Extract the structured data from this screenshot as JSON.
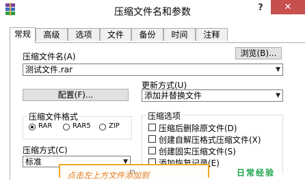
{
  "window": {
    "title": "压缩文件名和参数",
    "help_label": "?",
    "close_label": "✕",
    "app_icon": "winrar-books-icon"
  },
  "tabs": [
    {
      "label": "常规",
      "active": true
    },
    {
      "label": "高级",
      "active": false
    },
    {
      "label": "选项",
      "active": false
    },
    {
      "label": "文件",
      "active": false
    },
    {
      "label": "备份",
      "active": false
    },
    {
      "label": "时间",
      "active": false
    },
    {
      "label": "注释",
      "active": false
    }
  ],
  "general": {
    "archive_name_label": "压缩文件名(A)",
    "browse_button": "浏览(B)...",
    "archive_name_value": "测试文件.rar",
    "profiles_button": "配置(F)...",
    "update_mode_label": "更新方式(U)",
    "update_mode_value": "添加并替换文件",
    "format_group_label": "压缩文件格式",
    "format_options": [
      "RAR",
      "RAR5",
      "ZIP"
    ],
    "format_selected": "RAR",
    "options_group_label": "压缩选项",
    "options": [
      {
        "label": "压缩后删除原文件(D)",
        "checked": false
      },
      {
        "label": "创建自解压格式压缩文件(X)",
        "checked": false
      },
      {
        "label": "创建固实压缩文件(S)",
        "checked": false
      },
      {
        "label": "添加恢复记录(E)",
        "checked": false
      }
    ],
    "method_label": "压缩方式(C)",
    "method_value": "标准"
  },
  "annotation": {
    "text": "点击左上方文件添加到",
    "green_text": "日常经验"
  },
  "colors": {
    "close_button": "#c7504f",
    "annotation_border": "#f5a623",
    "annotation_text": "#e07b22",
    "green_text": "#1aa34a"
  }
}
